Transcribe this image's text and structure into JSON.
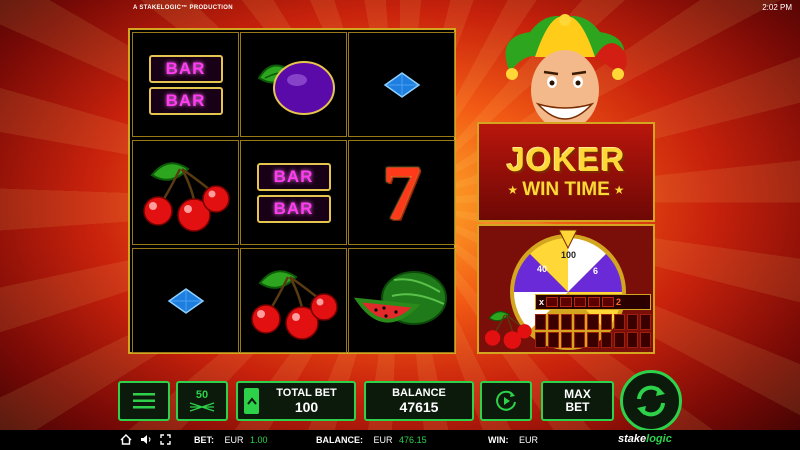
{
  "header": {
    "production": "A STAKELOGIC™ PRODUCTION",
    "clock": "2:02 PM"
  },
  "reels": {
    "symbols": [
      [
        "bar-bar",
        "plum",
        "blue-diamond"
      ],
      [
        "cherries",
        "bar-bar",
        "seven"
      ],
      [
        "blue-diamond",
        "cherries",
        "watermelon"
      ]
    ],
    "bar_text": "BAR",
    "seven_text": "7"
  },
  "logo": {
    "word1": "JOKER",
    "word2": "WIN TIME"
  },
  "wheel": {
    "labels": [
      "40",
      "100",
      "6"
    ],
    "multiplier_prefix": "x",
    "multiplier_value": "2"
  },
  "controls": {
    "lines": "50",
    "total_bet_label": "TOTAL BET",
    "total_bet_value": "100",
    "balance_label": "BALANCE",
    "balance_value": "47615",
    "max_bet_line1": "MAX",
    "max_bet_line2": "BET"
  },
  "status": {
    "bet_label": "BET:",
    "bet_currency": "EUR",
    "bet_value": "1.00",
    "balance_label": "BALANCE:",
    "balance_currency": "EUR",
    "balance_value": "476.15",
    "win_label": "WIN:",
    "win_currency": "EUR",
    "brand_a": "stake",
    "brand_b": "logic"
  },
  "colors": {
    "accent": "#2ed24a",
    "gold": "#d4a51f",
    "bar_text": "#ff3df0"
  }
}
